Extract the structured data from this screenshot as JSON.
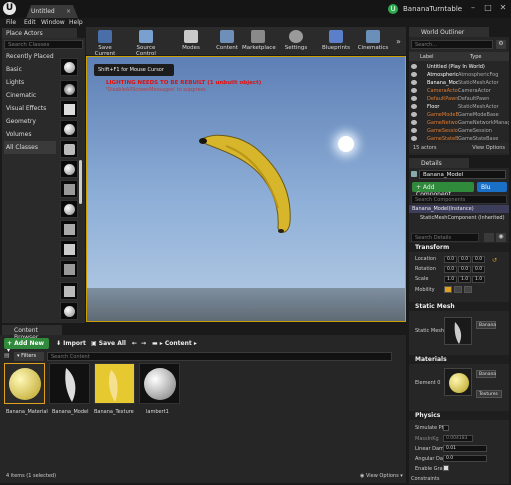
{
  "titlebar": {
    "logo": "U",
    "tab_label": "Untitled",
    "project_badge": "U",
    "project_name": "BananaTurntable",
    "win_min": "–",
    "win_max": "□",
    "win_close": "✕"
  },
  "menu": [
    "File",
    "Edit",
    "Window",
    "Help"
  ],
  "place_actors": {
    "tab": "Place Actors",
    "search_placeholder": "Search Classes",
    "categories": [
      "Recently Placed",
      "Basic",
      "Lights",
      "Cinematic",
      "Visual Effects",
      "Geometry",
      "Volumes",
      "All Classes"
    ]
  },
  "toolbar": {
    "buttons": [
      "Save Current",
      "Source Control",
      "Modes",
      "Content",
      "Marketplace",
      "Settings",
      "Blueprints",
      "Cinematics"
    ],
    "more": "»"
  },
  "viewport": {
    "hint": "Shift+F1 for Mouse Cursor",
    "warning": "LIGHTING NEEDS TO BE REBUILT (1 unbuilt object)",
    "warning_sub": "'DisableAllScreenMessages' to suppress"
  },
  "world_outliner": {
    "tab": "World Outliner",
    "search_placeholder": "Search...",
    "col_label": "Label",
    "col_type": "Type",
    "rows": [
      {
        "name": "Untitled (Play In World)",
        "type": "",
        "orange": false
      },
      {
        "name": "AtmosphericFog",
        "type": "AtmosphericFog",
        "orange": false
      },
      {
        "name": "Banana_Model",
        "type": "StaticMeshActor",
        "orange": false
      },
      {
        "name": "CameraActor",
        "type": "CameraActor",
        "orange": true
      },
      {
        "name": "DefaultPawn",
        "type": "DefaultPawn",
        "orange": true
      },
      {
        "name": "Floor",
        "type": "StaticMeshActor",
        "orange": false
      },
      {
        "name": "GameModeBase",
        "type": "GameModeBase",
        "orange": true
      },
      {
        "name": "GameNetworkManager",
        "type": "GameNetworkManager",
        "orange": true
      },
      {
        "name": "GameSession",
        "type": "GameSession",
        "orange": true
      },
      {
        "name": "GameStateBase",
        "type": "GameStateBase",
        "orange": true
      }
    ],
    "actor_count": "15 actors",
    "view_options": "View Options"
  },
  "details": {
    "tab": "Details",
    "name_value": "Banana_Model",
    "add_component": "+ Add Component",
    "blueprint_btn": "Blu",
    "search_components": "Search Components",
    "instance_label": "Banana_Model(Instance)",
    "component": "StaticMeshComponent (Inherited)",
    "search_details": "Search Details",
    "transform": "Transform",
    "location": "Location",
    "rotation": "Rotation",
    "scale": "Scale",
    "loc_vals": [
      "0.0",
      "0.0",
      "0.0"
    ],
    "rot_vals": [
      "0.0",
      "0.0",
      "0.0"
    ],
    "scale_vals": [
      "1.0",
      "1.0",
      "1.0"
    ],
    "mobility": "Mobility",
    "static_mesh_section": "Static Mesh",
    "static_mesh_label": "Static Mesh",
    "static_mesh_value": "Banana",
    "materials_section": "Materials",
    "element0": "Element 0",
    "material_value": "Banana",
    "textures": "Textures",
    "physics_section": "Physics",
    "simulate": "Simulate Phy",
    "mass": "MassInKg",
    "mass_val": "0.004183",
    "linear_damping": "Linear Damp",
    "linear_val": "0.01",
    "angular_damping": "Angular Dam",
    "angular_val": "0.0",
    "enable_gravity": "Enable Grav",
    "constraints": "Constraints"
  },
  "content_browser": {
    "tab": "Content Browser",
    "add_new": "Add New",
    "import": "Import",
    "save_all": "Save All",
    "path": "Content",
    "filters": "Filters",
    "search_placeholder": "Search Content",
    "assets": [
      {
        "name": "Banana_Material",
        "kind": "material"
      },
      {
        "name": "Banana_Model",
        "kind": "mesh"
      },
      {
        "name": "Banana_Texture",
        "kind": "texture"
      },
      {
        "name": "lambert1",
        "kind": "sphere"
      }
    ],
    "status": "4 items (1 selected)",
    "view_options": "View Options"
  }
}
